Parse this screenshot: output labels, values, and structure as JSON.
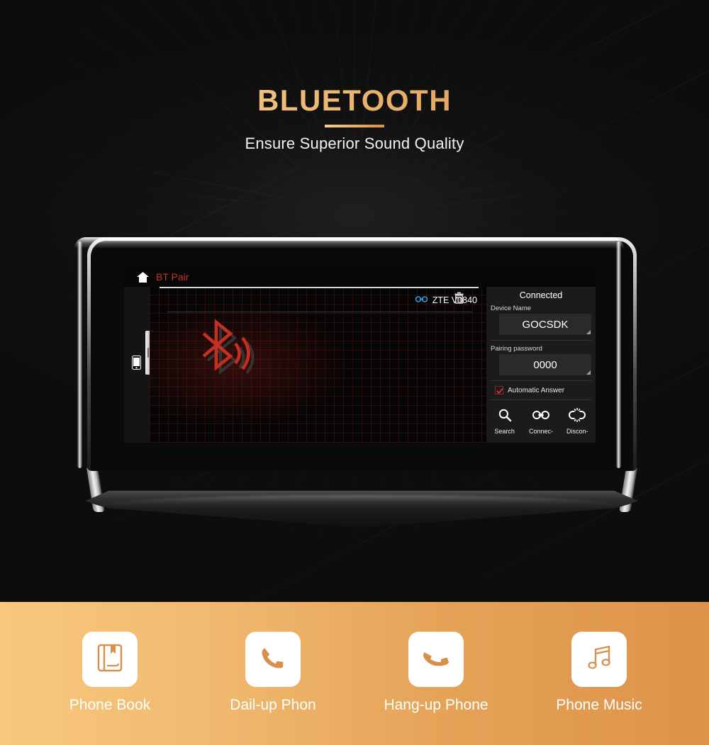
{
  "hero": {
    "title": "BLUETOOTH",
    "subtitle": "Ensure Superior Sound Quality",
    "accent_gold_light": "#f3cc8d",
    "accent_gold_dark": "#d08f3f"
  },
  "head_unit": {
    "screen": {
      "topbar": {
        "home_icon": "home-icon",
        "title": "BT Pair",
        "title_color": "#c4332b"
      },
      "left_rail": {
        "phone_icon": "phone-icon",
        "slider": "rail-slider"
      },
      "pairing": {
        "device_row": {
          "link_icon": "bluetooth-link-icon",
          "link_icon_color": "#2f9fe0",
          "device_name": "ZTE V0840",
          "delete_icon": "trash-icon"
        },
        "logo_icon": "bluetooth-logo-icon",
        "logo_color": "#c4301f"
      },
      "info_panel": {
        "status": "Connected",
        "fields": [
          {
            "label": "Device Name",
            "value": "GOCSDK"
          },
          {
            "label": "Pairing password",
            "value": "0000"
          }
        ],
        "checkbox": {
          "label": "Automatic Answer",
          "checked": true,
          "check_color": "#d0322a"
        },
        "buttons": [
          {
            "icon": "search-icon",
            "label": "Search"
          },
          {
            "icon": "link-icon",
            "label": "Connec-"
          },
          {
            "icon": "broken-link-icon",
            "label": "Discon-"
          }
        ]
      }
    }
  },
  "features": [
    {
      "icon": "phone-book-icon",
      "label": "Phone Book"
    },
    {
      "icon": "dial-phone-icon",
      "label": "Dail-up Phon"
    },
    {
      "icon": "hangup-phone-icon",
      "label": "Hang-up Phone"
    },
    {
      "icon": "music-note-icon",
      "label": "Phone Music"
    }
  ],
  "strip": {
    "gradient_start": "#f8c87e",
    "gradient_end": "#dd9349"
  }
}
